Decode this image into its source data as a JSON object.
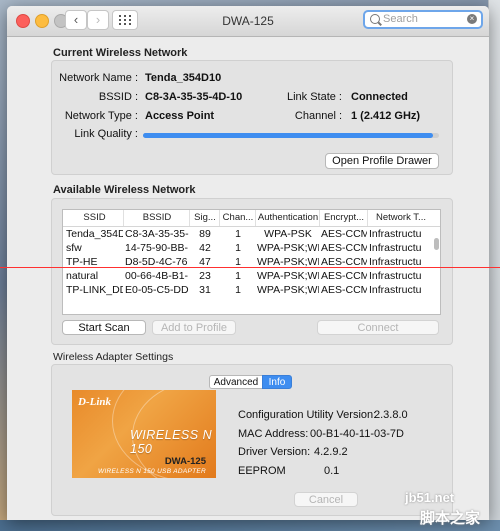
{
  "window": {
    "title": "DWA-125"
  },
  "search": {
    "placeholder": "Search"
  },
  "current": {
    "section_title": "Current Wireless Network",
    "network_name_label": "Network Name :",
    "network_name": "Tenda_354D10",
    "bssid_label": "BSSID :",
    "bssid": "C8-3A-35-35-4D-10",
    "network_type_label": "Network Type :",
    "network_type": "Access Point",
    "link_state_label": "Link State :",
    "link_state": "Connected",
    "channel_label": "Channel :",
    "channel": "1 (2.412 GHz)",
    "link_quality_label": "Link Quality :",
    "link_quality": 0.98,
    "open_profile_drawer": "Open Profile Drawer"
  },
  "available": {
    "section_title": "Available Wireless Network",
    "columns": [
      "SSID",
      "BSSID",
      "Sig...",
      "Chan...",
      "Authentication",
      "Encrypt...",
      "Network T..."
    ],
    "rows": [
      [
        "Tenda_354D",
        "C8-3A-35-35-",
        "89",
        "1",
        "WPA-PSK",
        "AES-CCM",
        "Infrastructu"
      ],
      [
        "sfw",
        "14-75-90-BB-",
        "42",
        "1",
        "WPA-PSK;WF",
        "AES-CCM",
        "Infrastructu"
      ],
      [
        "TP-HE",
        "D8-5D-4C-76",
        "47",
        "1",
        "WPA-PSK;WF",
        "AES-CCM",
        "Infrastructu"
      ],
      [
        "natural",
        "00-66-4B-B1-",
        "23",
        "1",
        "WPA-PSK;WF",
        "AES-CCM",
        "Infrastructu"
      ],
      [
        "TP-LINK_DD",
        "E0-05-C5-DD",
        "31",
        "1",
        "WPA-PSK;WF",
        "AES-CCM",
        "Infrastructu"
      ]
    ],
    "start_scan": "Start Scan",
    "add_to_profile": "Add to Profile",
    "connect": "Connect"
  },
  "adapter": {
    "section_title": "Wireless Adapter Settings",
    "tab_advanced": "Advanced",
    "tab_info": "Info",
    "logo": "D-Link",
    "product": "WIRELESS N 150",
    "model": "DWA-125",
    "tagline": "WIRELESS N 150 USB ADAPTER",
    "config_version_label": "Configuration Utility Version:",
    "config_version": "2.3.8.0",
    "mac_label": "MAC Address:",
    "mac": "00-B1-40-11-03-7D",
    "driver_label": "Driver Version:",
    "driver": "4.2.9.2",
    "eeprom_label": "EEPROM",
    "eeprom": "0.1",
    "cancel": "Cancel"
  },
  "watermark": {
    "line1": "jb51.net",
    "line2": "脚本之家"
  },
  "colors": {
    "accent": "#3e8df0",
    "close": "#fc605c",
    "minimize": "#fdbc40",
    "dlink_orange": "#e88a2a"
  }
}
